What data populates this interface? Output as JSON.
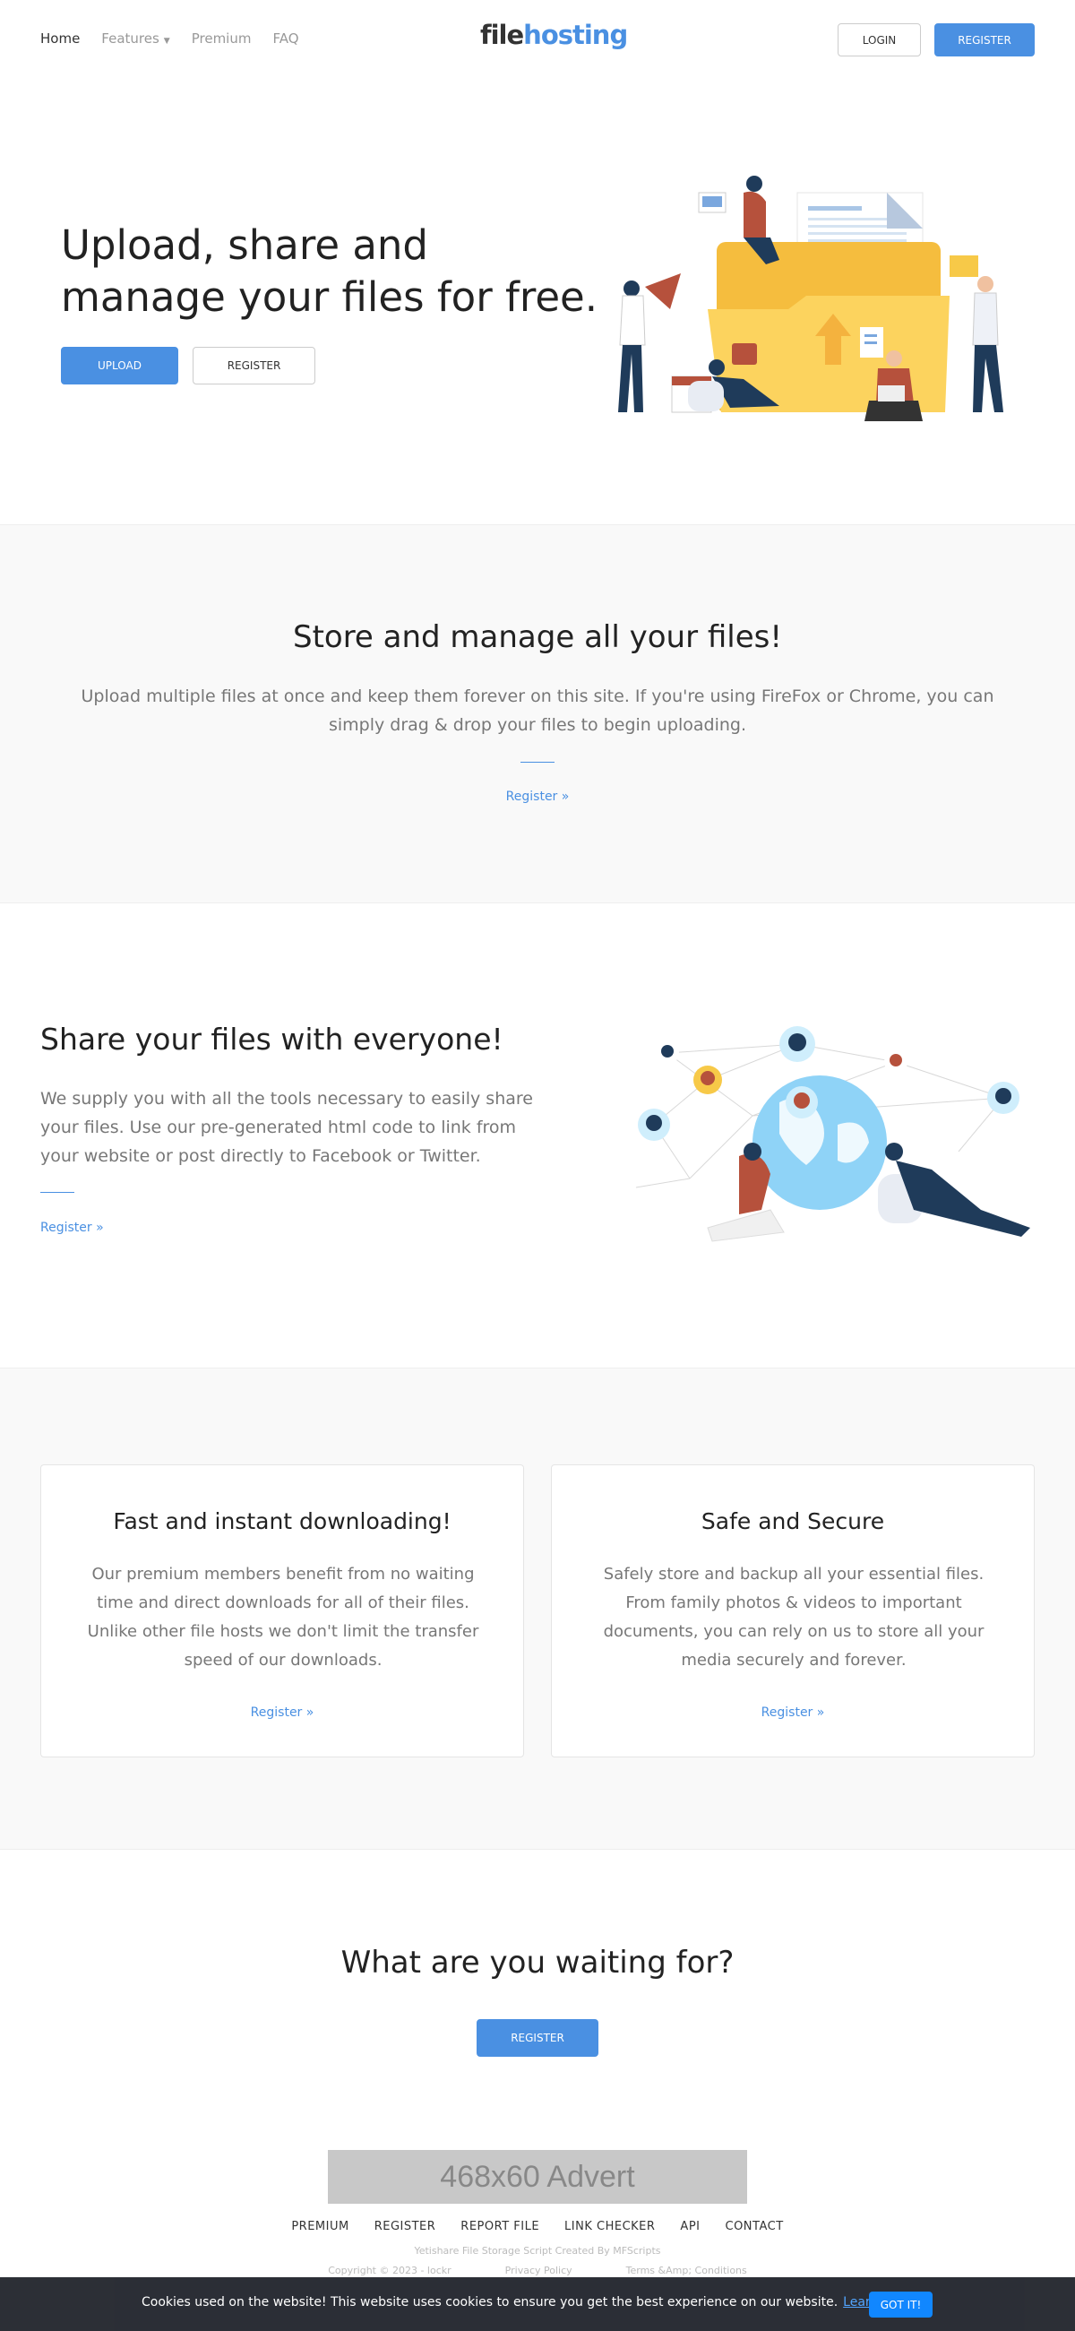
{
  "header": {
    "nav": [
      {
        "label": "Home"
      },
      {
        "label": "Features"
      },
      {
        "label": "Premium"
      },
      {
        "label": "FAQ"
      }
    ],
    "logo_part1": "file",
    "logo_part2": "hosting",
    "login_label": "LOGIN",
    "register_label": "REGISTER"
  },
  "hero": {
    "title_line1": "Upload, share and",
    "title_line2": "manage your files for free.",
    "upload_label": "UPLOAD",
    "register_label": "REGISTER"
  },
  "store": {
    "title": "Store and manage all your files!",
    "text": "Upload multiple files at once and keep them forever on this site. If you're using FireFox or Chrome, you can simply drag & drop your files to begin uploading.",
    "link": "Register »"
  },
  "share": {
    "title": "Share your files with everyone!",
    "text": "We supply you with all the tools necessary to easily share your files. Use our pre-generated html code to link from your website or post directly to Facebook or Twitter.",
    "link": "Register »"
  },
  "features": [
    {
      "title": "Fast and instant downloading!",
      "text": "Our premium members benefit from no waiting time and direct downloads for all of their files. Unlike other file hosts we don't limit the transfer speed of our downloads.",
      "link": "Register »"
    },
    {
      "title": "Safe and Secure",
      "text": "Safely store and backup all your essential files. From family photos & videos to important documents, you can rely on us to store all your media securely and forever.",
      "link": "Register »"
    }
  ],
  "cta": {
    "title": "What are you waiting for?",
    "button": "REGISTER"
  },
  "footer": {
    "advert": "468x60 Advert",
    "links": [
      "PREMIUM",
      "REGISTER",
      "REPORT FILE",
      "LINK CHECKER",
      "API",
      "CONTACT"
    ],
    "credit": "Yetishare File Storage Script Created By MFScripts",
    "copyright": "Copyright © 2023 - lockr",
    "privacy": "Privacy Policy",
    "terms": "Terms &Amp; Conditions"
  },
  "cookie": {
    "text": "Cookies used on the website!  This website uses cookies to ensure you get the best experience on our website.",
    "link": "Learn more",
    "button": "GOT IT!"
  },
  "colors": {
    "accent": "#4a90e2",
    "folder": "#fcd35e",
    "globe": "#8fd3f7",
    "cookie_bg": "#252830",
    "cookie_btn": "#0a84ff"
  }
}
